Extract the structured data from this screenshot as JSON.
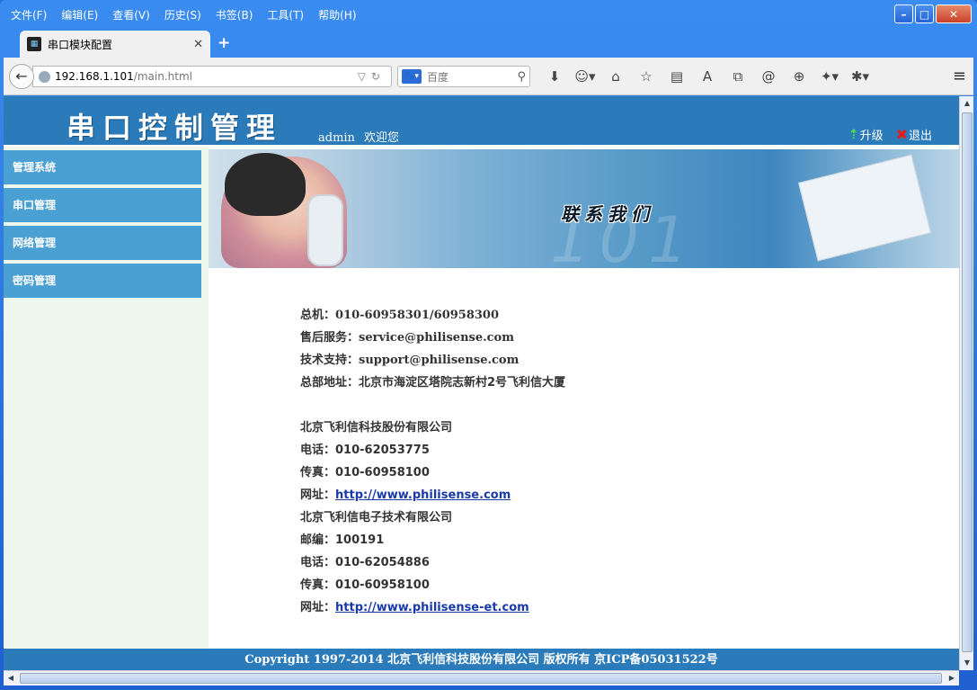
{
  "browser": {
    "menus": [
      "文件(F)",
      "编辑(E)",
      "查看(V)",
      "历史(S)",
      "书签(B)",
      "工具(T)",
      "帮助(H)"
    ],
    "tab_title": "串口模块配置",
    "url_host": "192.168.1.101",
    "url_path": "/main.html",
    "search_placeholder": "百度"
  },
  "page": {
    "logo": "串口控制管理",
    "username": "admin",
    "welcome": "欢迎您",
    "upgrade": "升级",
    "logout": "退出",
    "sidebar": [
      "管理系统",
      "串口管理",
      "网络管理",
      "密码管理"
    ],
    "banner_title": "联系我们",
    "contact": {
      "switchboard": "总机：010-60958301/60958300",
      "aftersales": "售后服务：service@philisense.com",
      "support": "技术支持：support@philisense.com",
      "address": "总部地址：北京市海淀区塔院志新村2号飞利信大厦",
      "company1": "北京飞利信科技股份有限公司",
      "phone1": "电话：010-62053775",
      "fax1": "传真：010-60958100",
      "web1_label": "网址：",
      "web1": "http://www.philisense.com",
      "company2": "北京飞利信电子技术有限公司",
      "postcode": "邮编：100191",
      "phone2": "电话：010-62054886",
      "fax2": "传真：010-60958100",
      "web2_label": "网址：",
      "web2": "http://www.philisense-et.com"
    },
    "footer": "Copyright  1997-2014  北京飞利信科技股份有限公司 版权所有     京ICP备05031522号"
  },
  "colors": {
    "header_blue": "#2b7bbb",
    "sidebar_item": "#4a9fd3",
    "sidebar_bg": "#eef7ee"
  }
}
